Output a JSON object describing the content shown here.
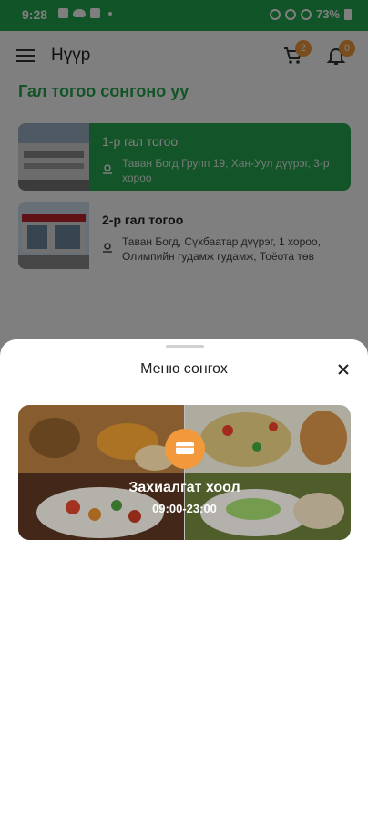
{
  "status_bar": {
    "time": "9:28",
    "battery": "73%"
  },
  "app_bar": {
    "title": "Нүүр",
    "cart_count": "2",
    "notification_count": "0"
  },
  "section": {
    "title": "Гал тогоо сонгоно уу"
  },
  "kitchens": [
    {
      "name": "1-р гал тогоо",
      "address": "Таван Богд Групп 19, Хан-Уул дүүрэг, 3-р хороо",
      "selected": true
    },
    {
      "name": "2-р гал тогоо",
      "address": "Таван Богд, Сүхбаатар дүүрэг, 1 хороо, Олимпийн гудамж гудамж, Тоёота төв",
      "selected": false
    }
  ],
  "sheet": {
    "title": "Меню сонгох",
    "menu": {
      "name": "Захиалгат хоол",
      "hours": "09:00-23:00"
    }
  },
  "colors": {
    "brand_green": "#22a84f",
    "accent_orange": "#f29a3b"
  }
}
